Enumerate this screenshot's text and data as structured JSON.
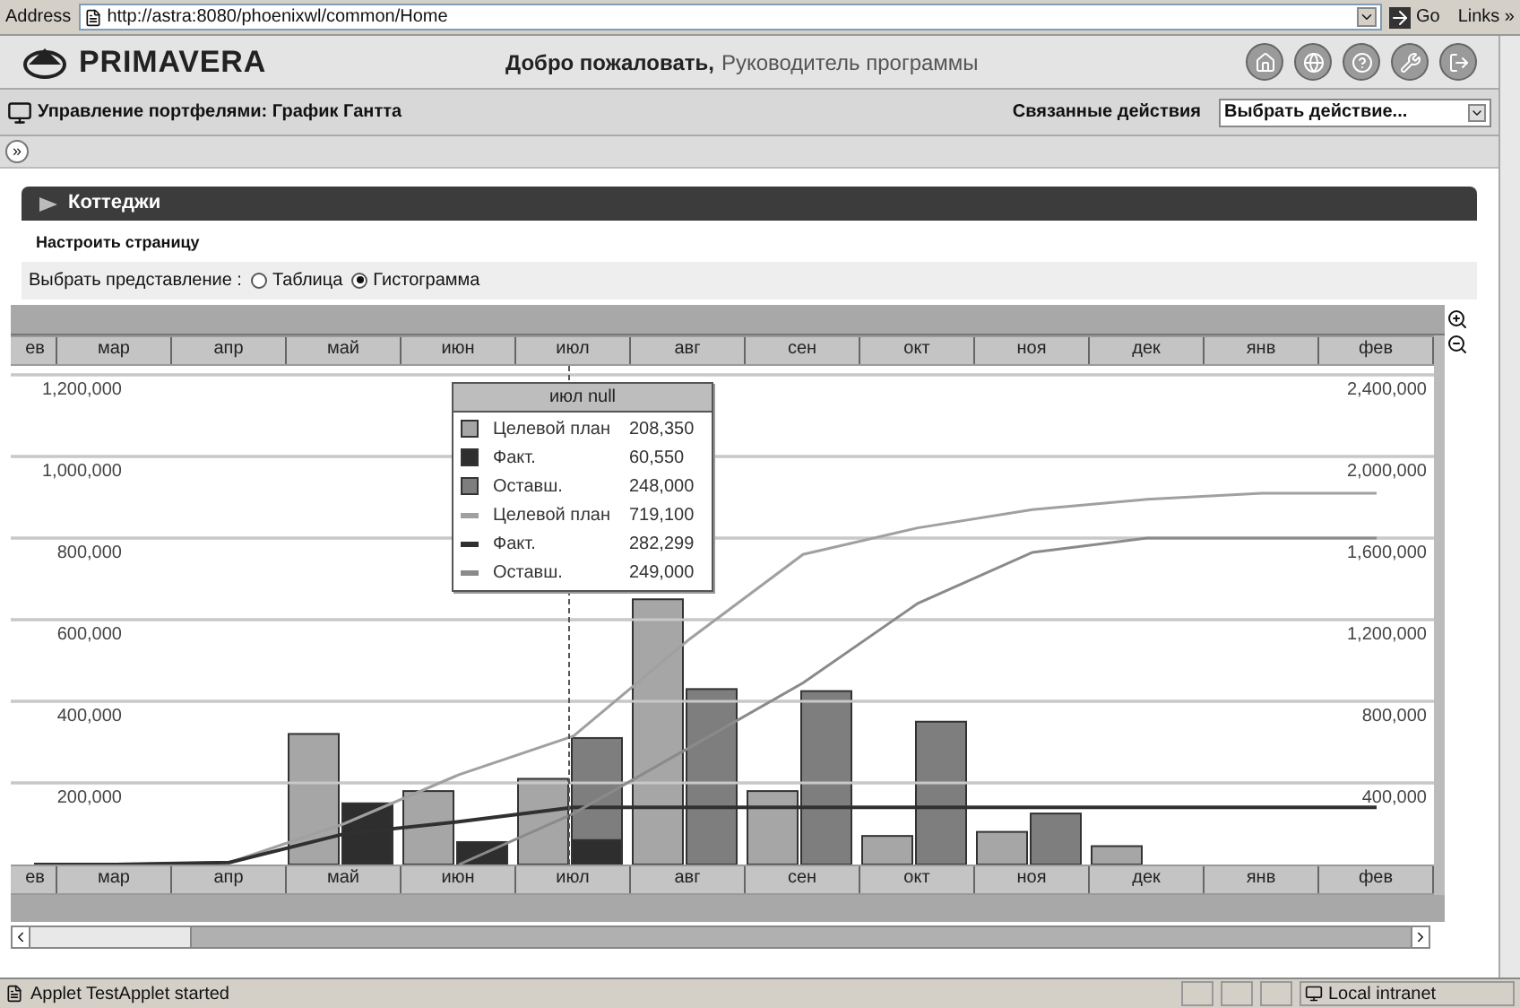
{
  "browser": {
    "address_label": "Address",
    "url": "http://astra:8080/phoenixwl/common/Home",
    "go": "Go",
    "links": "Links »"
  },
  "header": {
    "logo": "PRIMAVERA",
    "welcome": "Добро пожаловать,",
    "user": "Руководитель программы"
  },
  "toolbar": {
    "title": "Управление портфелями: График Гантта",
    "related_label": "Связанные действия",
    "action_select": "Выбрать действие..."
  },
  "expand_button": "»",
  "panel": {
    "title": "Коттеджи",
    "customize_link": "Настроить страницу",
    "view_label": "Выбрать представление :",
    "views": [
      {
        "label": "Таблица",
        "selected": false
      },
      {
        "label": "Гистограмма",
        "selected": true
      }
    ]
  },
  "chart": {
    "bar_chart": {
      "chart_data": {
        "type": "bar",
        "categories": [
          "ев",
          "мар",
          "апр",
          "май",
          "июн",
          "июл",
          "авг",
          "сен",
          "окт",
          "ноя",
          "дек",
          "янв",
          "фев"
        ],
        "ylim": [
          0,
          1200000
        ],
        "yticks": [
          {
            "value": 200000,
            "label": "200,000"
          },
          {
            "value": 400000,
            "label": "400,000"
          },
          {
            "value": 600000,
            "label": "600,000"
          },
          {
            "value": 800000,
            "label": "800,000"
          },
          {
            "value": 1000000,
            "label": "1,000,000"
          },
          {
            "value": 1200000,
            "label": "1,200,000"
          }
        ],
        "grid": true,
        "series": [
          {
            "color": "#a6a6a6",
            "values": [
              null,
              null,
              null,
              320000,
              180000,
              210000,
              650000,
              180000,
              70000,
              80000,
              45000,
              null,
              null
            ]
          },
          {
            "color": "#7e7e7e",
            "values": [
              null,
              null,
              null,
              null,
              null,
              310000,
              430000,
              425000,
              350000,
              125000,
              null,
              null,
              null
            ]
          },
          {
            "color": "#2e2e2e",
            "values": [
              null,
              null,
              null,
              150000,
              55000,
              60000,
              null,
              null,
              null,
              null,
              null,
              null,
              null
            ]
          }
        ]
      }
    },
    "line_chart": {
      "chart_data": {
        "type": "line",
        "categories": [
          "ев",
          "мар",
          "апр",
          "май",
          "июн",
          "июл",
          "авг",
          "сен",
          "окт",
          "ноя",
          "дек",
          "янв",
          "фев"
        ],
        "ylim": [
          0,
          2400000
        ],
        "yticks": [
          {
            "value": 400000,
            "label": "400,000"
          },
          {
            "value": 800000,
            "label": "800,000"
          },
          {
            "value": 1200000,
            "label": "1,200,000"
          },
          {
            "value": 1600000,
            "label": "1,600,000"
          },
          {
            "value": 2000000,
            "label": "2,000,000"
          },
          {
            "value": 2400000,
            "label": "2,400,000"
          }
        ],
        "grid": true,
        "series": [
          {
            "color": "#a0a0a0",
            "values": [
              0,
              0,
              10000,
              200000,
              440000,
              630000,
              1100000,
              1520000,
              1650000,
              1740000,
              1790000,
              1820000,
              1820000
            ]
          },
          {
            "color": "#303030",
            "values": [
              0,
              0,
              10000,
              150000,
              210000,
              280000,
              280000,
              280000,
              280000,
              280000,
              280000,
              280000,
              280000
            ]
          },
          {
            "color": "#8a8a8a",
            "values": [
              null,
              null,
              null,
              null,
              0,
              250000,
              570000,
              890000,
              1280000,
              1530000,
              1600000,
              1600000,
              1600000
            ]
          }
        ]
      }
    },
    "tooltip": {
      "title": "июл null",
      "items": [
        {
          "kind": "bar",
          "label": "Целевой план",
          "value": "208,350",
          "color": "#a6a6a6"
        },
        {
          "kind": "bar",
          "label": "Факт.",
          "value": "60,550",
          "color": "#2e2e2e"
        },
        {
          "kind": "bar",
          "label": "Оставш.",
          "value": "248,000",
          "color": "#7e7e7e"
        },
        {
          "kind": "line",
          "label": "Целевой план",
          "value": "719,100",
          "color": "#a0a0a0"
        },
        {
          "kind": "line",
          "label": "Факт.",
          "value": "282,299",
          "color": "#303030"
        },
        {
          "kind": "line",
          "label": "Оставш.",
          "value": "249,000",
          "color": "#8a8a8a"
        }
      ]
    }
  },
  "status_bar": {
    "message": "Applet TestApplet started",
    "zone": "Local intranet"
  }
}
